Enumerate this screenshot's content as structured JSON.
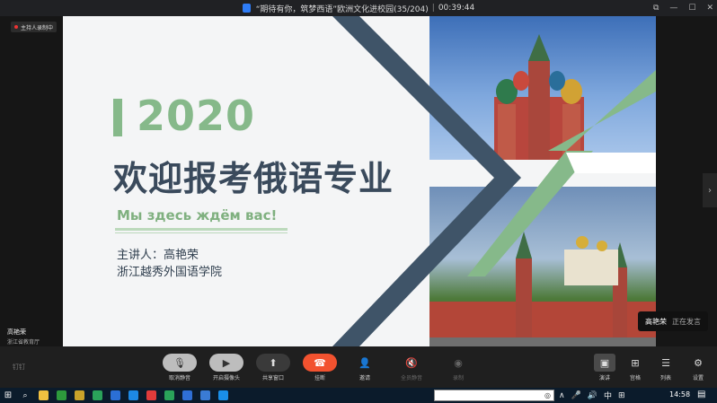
{
  "window": {
    "title": "“期待有你，筑梦西语”欧洲文化进校园(35/204)",
    "timer": "00:39:44",
    "controls": [
      "⧉",
      "—",
      "☐",
      "✕"
    ]
  },
  "recording_badge": "主持人录制中",
  "slide": {
    "year": "2020",
    "headline": "欢迎报考俄语专业",
    "subtitle": "Мы здесь ждём вас!",
    "speaker": "主讲人：高艳荣",
    "institution": "浙江越秀外国语学院"
  },
  "participant": {
    "name": "高艳荣",
    "org": "浙江省教育厅"
  },
  "speaking_indicator": {
    "name": "高艳荣",
    "status": "正在发言"
  },
  "brand": "钉钉",
  "toolbar": [
    {
      "id": "mute",
      "label": "取消静音",
      "icon": "mic-off-icon",
      "glyph": "🎙"
    },
    {
      "id": "camera",
      "label": "开启摄像头",
      "icon": "camera-icon",
      "glyph": "▶"
    },
    {
      "id": "share",
      "label": "共享窗口",
      "icon": "share-icon",
      "glyph": "⬆"
    },
    {
      "id": "hangup",
      "label": "挂断",
      "icon": "phone-icon",
      "glyph": "☎"
    },
    {
      "id": "invite",
      "label": "邀请",
      "icon": "invite-icon",
      "glyph": "👤"
    },
    {
      "id": "mute_all",
      "label": "全员静音",
      "icon": "mute-all-icon",
      "glyph": "🔇"
    },
    {
      "id": "record",
      "label": "录制",
      "icon": "record-icon",
      "glyph": "◉"
    }
  ],
  "views": [
    {
      "id": "presenter",
      "label": "演讲",
      "glyph": "▣",
      "active": true
    },
    {
      "id": "grid",
      "label": "宫格",
      "glyph": "⊞",
      "active": false
    },
    {
      "id": "list",
      "label": "列表",
      "glyph": "☰",
      "active": false
    },
    {
      "id": "settings",
      "label": "设置",
      "glyph": "⚙",
      "active": false
    }
  ],
  "taskbar": {
    "apps": [
      "#f0c040",
      "#2d9a3c",
      "#c9a22a",
      "#2aa35a",
      "#2b6fd6",
      "#1d89e4",
      "#e03b3b",
      "#2aa35a",
      "#2f6fd6",
      "#3a7bd5",
      "#1a8fe8"
    ],
    "tray": [
      "∧",
      "🎤",
      "🔊",
      "中",
      "⊞"
    ],
    "time": "14:58"
  },
  "colors": {
    "accent_green": "#86b98a",
    "navy": "#3a4a5c",
    "hangup_red": "#f2522f"
  }
}
